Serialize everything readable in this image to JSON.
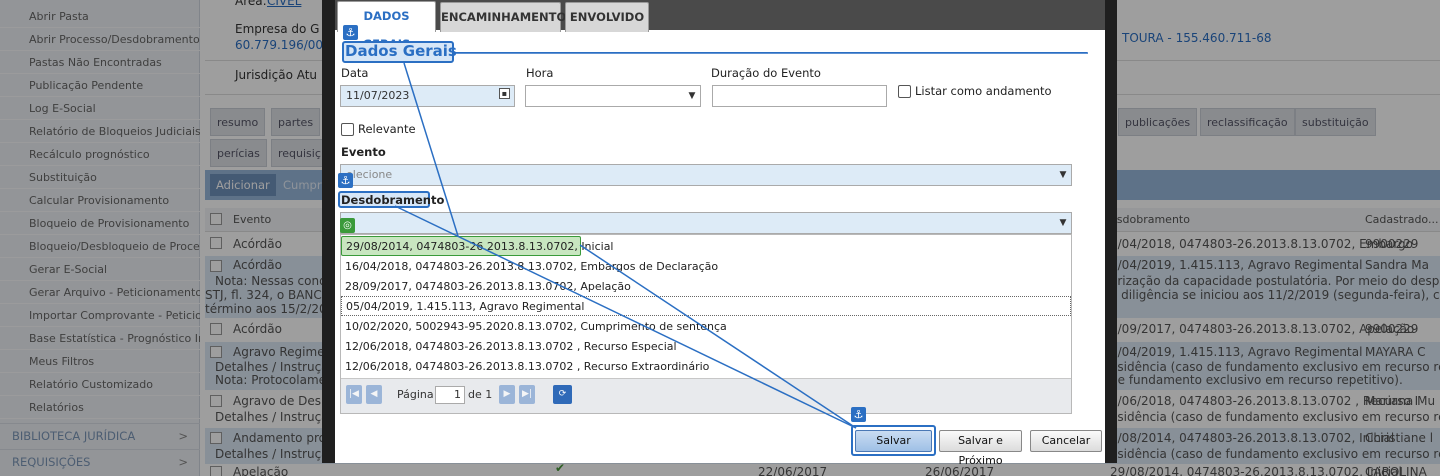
{
  "sidebar": {
    "items": [
      "Abrir Pasta",
      "Abrir Processo/Desdobramento",
      "Pastas Não Encontradas",
      "Publicação Pendente",
      "Log E-Social",
      "Relatório de Bloqueios Judiciais",
      "Recálculo prognóstico",
      "Substituição",
      "Calcular Provisionamento",
      "Bloqueio de Provisionamento",
      "Bloqueio/Desbloqueio de Processo",
      "Gerar E-Social",
      "Gerar Arquivo - Peticionamento Ele",
      "Importar Comprovante - Peticiona",
      "Base Estatística - Prognóstico Inteli",
      "Meus Filtros",
      "Relatório Customizado",
      "Relatórios"
    ],
    "sections": [
      "BIBLIOTECA JURÍDICA",
      "REQUISIÇÕES"
    ]
  },
  "background": {
    "area_label": "Área:",
    "area_value": "CIVEL",
    "empresa_label": "Empresa do G",
    "empresa_value": "60.779.196/00",
    "right_value": "TOURA - 155.460.711-68",
    "jurisdicao_label": "Jurisdição Atu",
    "tabs_row1": [
      "resumo",
      "partes"
    ],
    "tabs_right": [
      "publicações",
      "reclassificação",
      "substituição"
    ],
    "tabs_row2": [
      "perícias",
      "requisiç"
    ],
    "add_button": "Adicionar",
    "cumprir_button": "Cumpri",
    "col_evento": "Evento",
    "col_desdobramento": "esdobramento",
    "col_cadastrado": "Cadastrado...",
    "rows": [
      {
        "evento": "Acórdão",
        "desd": "5/04/2018, 0474803-26.2013.8.13.0702, Embargo",
        "cad": "9900229"
      },
      {
        "evento": "Acórdão",
        "desd": "5/04/2019, 1.415.113, Agravo Regimental",
        "cad": "Sandra Ma"
      },
      {
        "evento": "Acórdão",
        "desd": "8/09/2017, 0474803-26.2013.8.13.0702, Apelação",
        "cad": "9900229"
      },
      {
        "evento": "Agravo Regiment",
        "desd": "5/04/2019, 1.415.113, Agravo Regimental",
        "cad": "MAYARA C"
      },
      {
        "evento": "Agravo de Despa",
        "desd": "2/06/2018, 0474803-26.2013.8.13.0702 , Recurso I",
        "cad": "Mariana Mu"
      },
      {
        "evento": "Andamento proc",
        "desd": "9/08/2014, 0474803-26.2013.8.13.0702, Inicial",
        "cad": "Christiane l"
      },
      {
        "evento": "Apelação",
        "desd": "29/08/2014, 0474803-26.2013.8.13.0702, Inicial",
        "cad": "CAROLINA"
      }
    ],
    "note_left_1": "Nota: Nessas cond",
    "note_left_2": "STJ, fl. 324, o BANCO fo",
    "note_left_3": "término aos 15/2/2019",
    "note_right_1": "arização da capacidade postulatória. Por meio do despacho de",
    "note_right_2": "a diligência se iniciou aos 11/2/2019 (segunda-feira), com",
    "detalhes_1": "Detalhes / Instruçã",
    "nota_protocolamento": "Nota: Protocolame",
    "detalhes_right_1": "esidência (caso de fundamento exclusivo em recurso repetitivo",
    "detalhes_right_2": "de fundamento exclusivo em recurso repetitivo).",
    "detalhes_right_3": "esidência (caso de fundamento exclusivo em recurso repetitiv",
    "detalhes_right_4": "esidência (caso de fundamento exclusivo em recurso repetitiv",
    "date_1": "22/06/2017",
    "date_2": "26/06/2017"
  },
  "modal": {
    "tabs": [
      "DADOS GERAIS",
      "ENCAMINHAMENTO",
      "ENVOLVIDO"
    ],
    "section_title": "Dados Gerais",
    "data_label": "Data",
    "data_value": "11/07/2023",
    "hora_label": "Hora",
    "duracao_label": "Duração do Evento",
    "listar_label": "Listar como andamento",
    "relevante_label": "Relevante",
    "evento_label": "Evento",
    "evento_placeholder": "elecione",
    "desdobramento_label": "Desdobramento",
    "options": [
      "29/08/2014, 0474803-26.2013.8.13.0702, Inicial",
      "16/04/2018, 0474803-26.2013.8.13.0702, Embargos de Declaração",
      "28/09/2017, 0474803-26.2013.8.13.0702, Apelação",
      "05/04/2019, 1.415.113, Agravo Regimental",
      "10/02/2020, 5002943-95.2020.8.13.0702, Cumprimento de sentença",
      "12/06/2018, 0474803-26.2013.8.13.0702 , Recurso Especial",
      "12/06/2018, 0474803-26.2013.8.13.0702 , Recurso Extraordinário"
    ],
    "pager": {
      "label": "Página",
      "page": "1",
      "of": "de 1"
    },
    "buttons": {
      "save": "Salvar",
      "save_next": "Salvar e Próximo",
      "cancel": "Cancelar"
    }
  },
  "colors": {
    "accent": "#2b6fc3",
    "highlight": "#c8e6c0",
    "highlight_border": "#3a9a3a"
  }
}
